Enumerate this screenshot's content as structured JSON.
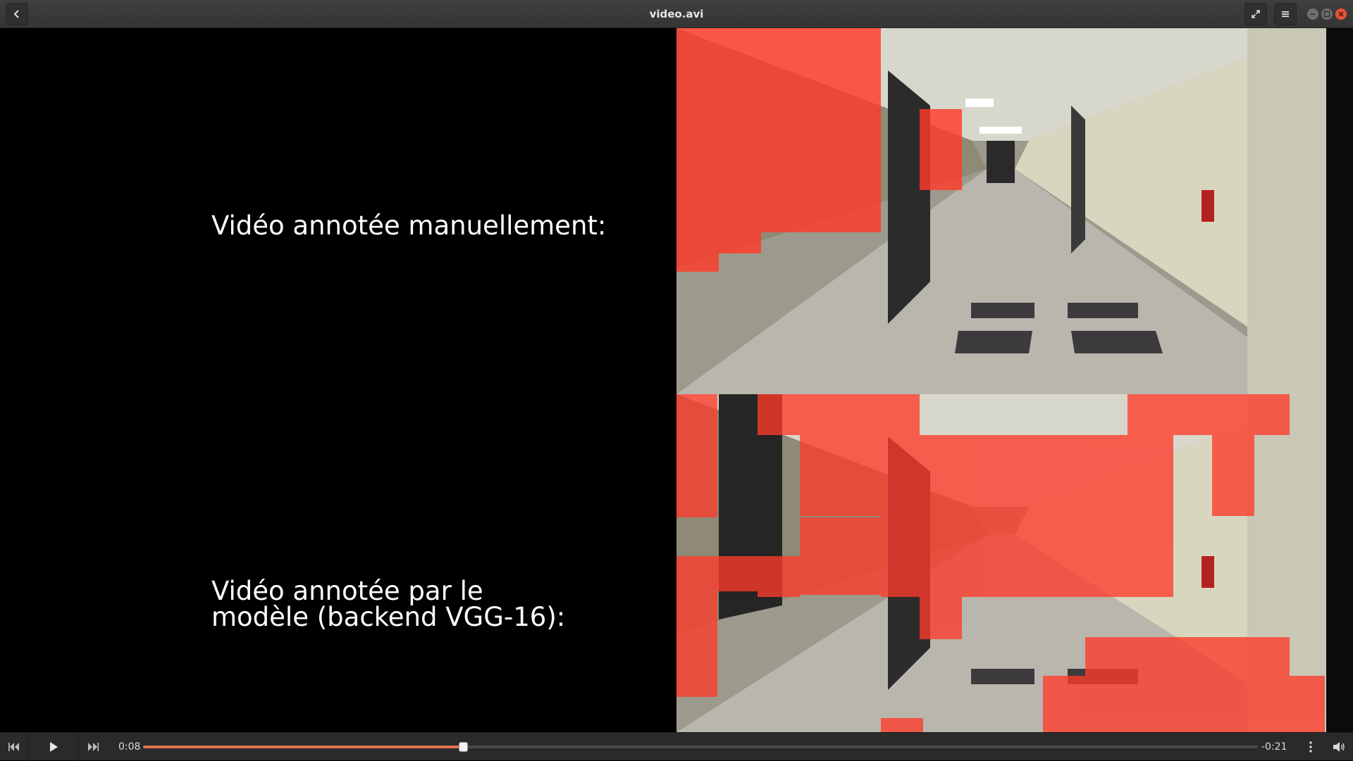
{
  "window": {
    "title": "video.avi"
  },
  "icons": {
    "back": "chevron-left-icon",
    "fullscreen": "expand-icon",
    "menu": "hamburger-menu-icon",
    "previous": "skip-previous-icon",
    "play": "play-icon",
    "next": "skip-next-icon",
    "more": "vertical-dots-icon",
    "volume": "speaker-icon"
  },
  "video": {
    "caption_top": "Vidéo annotée manuellement:",
    "caption_bottom_line1": "Vidéo annotée par le",
    "caption_bottom_line2": "modèle (backend VGG-16):"
  },
  "playback": {
    "elapsed": "0:08",
    "remaining": "-0:21",
    "progress": 0.287
  },
  "colors": {
    "accent": "#e2704c",
    "close": "#e5533b",
    "overlay": "#ff3b2a"
  }
}
